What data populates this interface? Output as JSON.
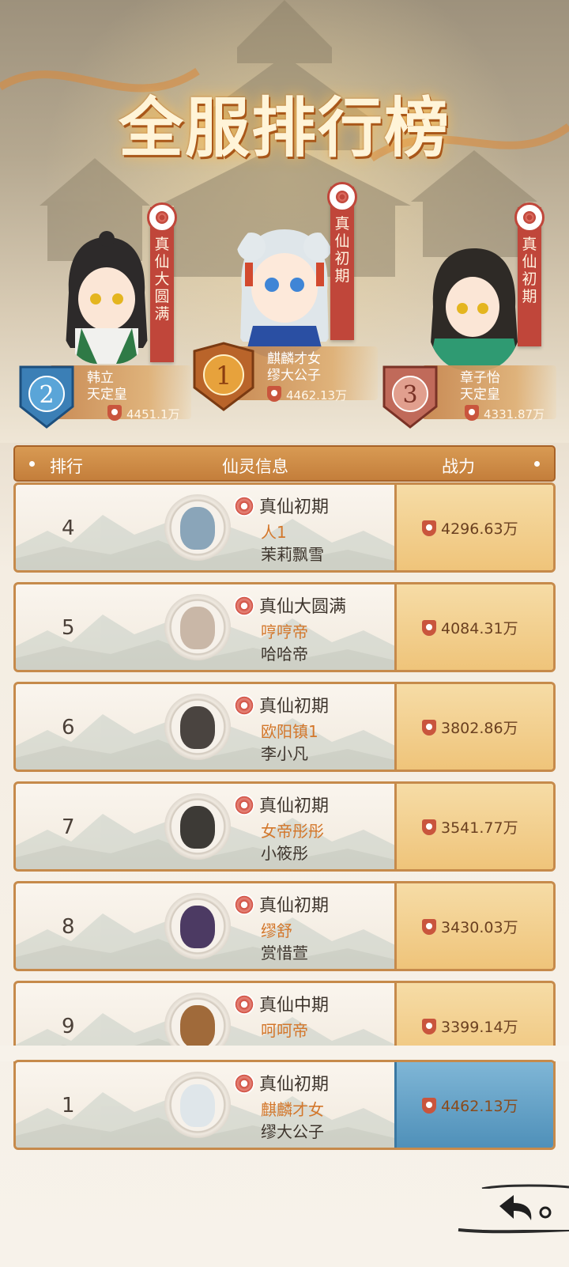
{
  "title": "全服排行榜",
  "podium": [
    {
      "rank": "2",
      "realm_lines": [
        "真",
        "仙",
        "大",
        "圆",
        "满"
      ],
      "sect": "韩立",
      "name": "天定皇",
      "power": "4451.1万"
    },
    {
      "rank": "1",
      "realm_lines": [
        "真",
        "仙",
        "初",
        "期"
      ],
      "sect": "麒麟才女",
      "name": "缪大公子",
      "power": "4462.13万"
    },
    {
      "rank": "3",
      "realm_lines": [
        "真",
        "仙",
        "初",
        "期"
      ],
      "sect": "章子怡",
      "name": "天定皇",
      "power": "4331.87万"
    }
  ],
  "table_header": {
    "rank": "排行",
    "info": "仙灵信息",
    "power": "战力"
  },
  "rows": [
    {
      "rank": "4",
      "realm": "真仙初期",
      "sect": "人1",
      "name": "茉莉飘雪",
      "power": "4296.63万"
    },
    {
      "rank": "5",
      "realm": "真仙大圆满",
      "sect": "哼哼帝",
      "name": "哈哈帝",
      "power": "4084.31万"
    },
    {
      "rank": "6",
      "realm": "真仙初期",
      "sect": "欧阳镇1",
      "name": "李小凡",
      "power": "3802.86万"
    },
    {
      "rank": "7",
      "realm": "真仙初期",
      "sect": "女帝彤彤",
      "name": "小筱彤",
      "power": "3541.77万"
    },
    {
      "rank": "8",
      "realm": "真仙初期",
      "sect": "缪舒",
      "name": "赏惜萱",
      "power": "3430.03万"
    },
    {
      "rank": "9",
      "realm": "真仙中期",
      "sect": "呵呵帝",
      "name": "",
      "power": "3399.14万"
    }
  ],
  "my_row": {
    "rank": "1",
    "realm": "真仙初期",
    "sect": "麒麟才女",
    "name": "缪大公子",
    "power": "4462.13万"
  },
  "colors": {
    "accent": "#c47e3b",
    "highlight": "#4f90b9",
    "sect_text": "#d3772b"
  }
}
